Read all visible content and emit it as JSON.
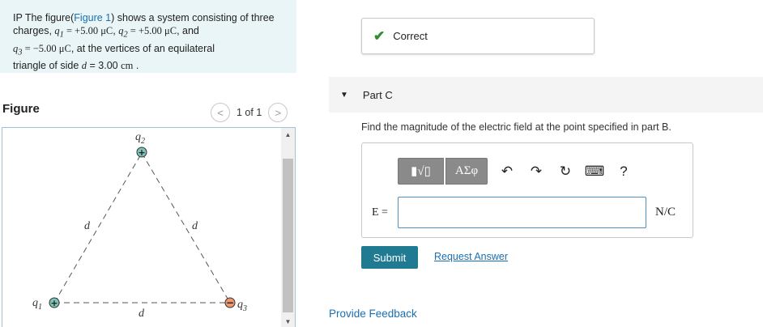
{
  "problem": {
    "prefix": "IP The figure(",
    "figure_link": "Figure 1",
    "after_link": ") shows a system consisting of three",
    "line2_a": "charges, ",
    "q1": "q",
    "q1_sub": "1",
    "eq1": " = +5.00 μC",
    "comma1": ", ",
    "q2": "q",
    "q2_sub": "2",
    "eq2": " = +5.00 μC",
    "and": ", and",
    "q3": "q",
    "q3_sub": "3",
    "eq3": " = −5.00 μC",
    "line3_b": ", at the vertices of an equilateral",
    "line4_a": "triangle of side ",
    "d": "d",
    "line4_b": " = 3.00 ",
    "unit_cm": "cm",
    "period": " ."
  },
  "figure_panel": {
    "title": "Figure",
    "pager": "1 of 1",
    "prev_icon": "<",
    "next_icon": ">"
  },
  "diagram": {
    "q1_label": "q",
    "q1_sub": "1",
    "q2_label": "q",
    "q2_sub": "2",
    "q3_label": "q",
    "q3_sub": "3",
    "side_left": "d",
    "side_right": "d",
    "side_bottom": "d",
    "plus": "+",
    "minus": "−",
    "color_positive": "#7cc3b8",
    "color_negative": "#f0966e"
  },
  "status": {
    "check_icon": "✔",
    "text": "Correct"
  },
  "part": {
    "toggle_icon": "▼",
    "title": "Part C"
  },
  "question": "Find the magnitude of the electric field at the point specified in part B.",
  "answer": {
    "toolbar": {
      "templates_icon": "▮√▯",
      "symbols": "ΑΣφ",
      "undo_icon": "↶",
      "redo_icon": "↷",
      "reset_icon": "↻",
      "keyboard_icon": "⌨",
      "help": "?"
    },
    "label": "E =",
    "value": "",
    "unit": "N/C"
  },
  "actions": {
    "submit": "Submit",
    "request": "Request Answer",
    "feedback": "Provide Feedback"
  },
  "colors": {
    "link": "#1a6fb0",
    "submit_bg": "#1f7a92",
    "problem_bg": "#e9f5f6",
    "correct_green": "#2f8f2f"
  }
}
